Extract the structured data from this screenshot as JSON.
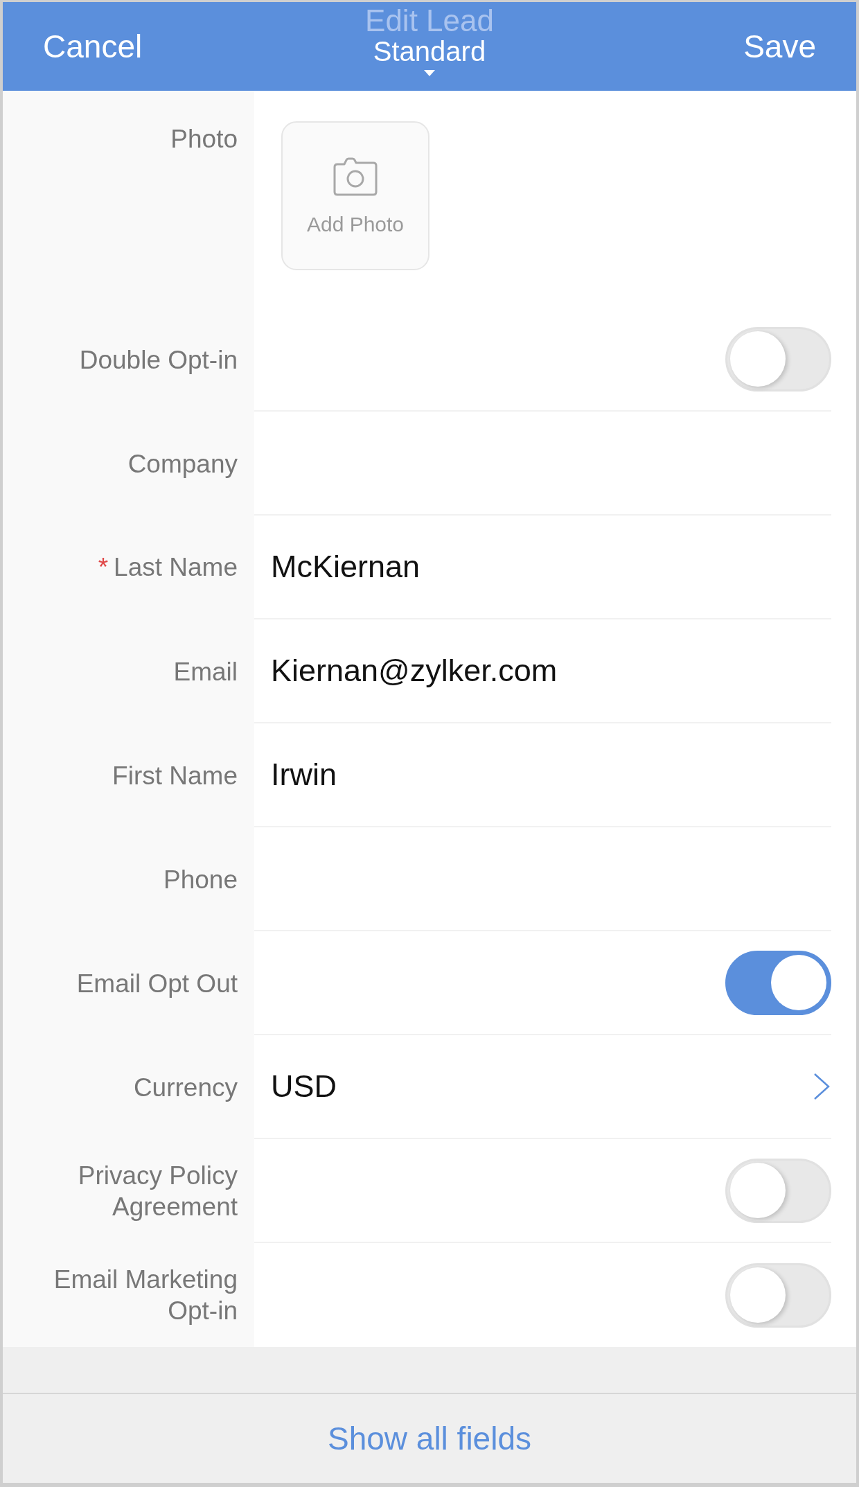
{
  "header": {
    "cancel": "Cancel",
    "title": "Edit Lead",
    "layout": "Standard",
    "save": "Save"
  },
  "photo": {
    "label": "Photo",
    "action": "Add Photo"
  },
  "fields": [
    {
      "kind": "toggle",
      "label": "Double Opt-in",
      "on": false
    },
    {
      "kind": "text",
      "label": "Company"
    },
    {
      "kind": "text",
      "label": "Last Name",
      "required_mark": "*",
      "value": "McKiernan"
    },
    {
      "kind": "text",
      "label": "Email",
      "value": "Kiernan@zylker.com"
    },
    {
      "kind": "text",
      "label": "First Name",
      "value": "Irwin"
    },
    {
      "kind": "text",
      "label": "Phone"
    },
    {
      "kind": "toggle",
      "label": "Email Opt Out",
      "on": true
    },
    {
      "kind": "picker",
      "label": "Currency",
      "value": "USD"
    },
    {
      "kind": "toggle",
      "label": "Privacy Policy Agreement",
      "on": false
    },
    {
      "kind": "toggle",
      "label": "Email Marketing Opt-in",
      "on": false
    }
  ],
  "footer": {
    "action": "Show all fields"
  }
}
